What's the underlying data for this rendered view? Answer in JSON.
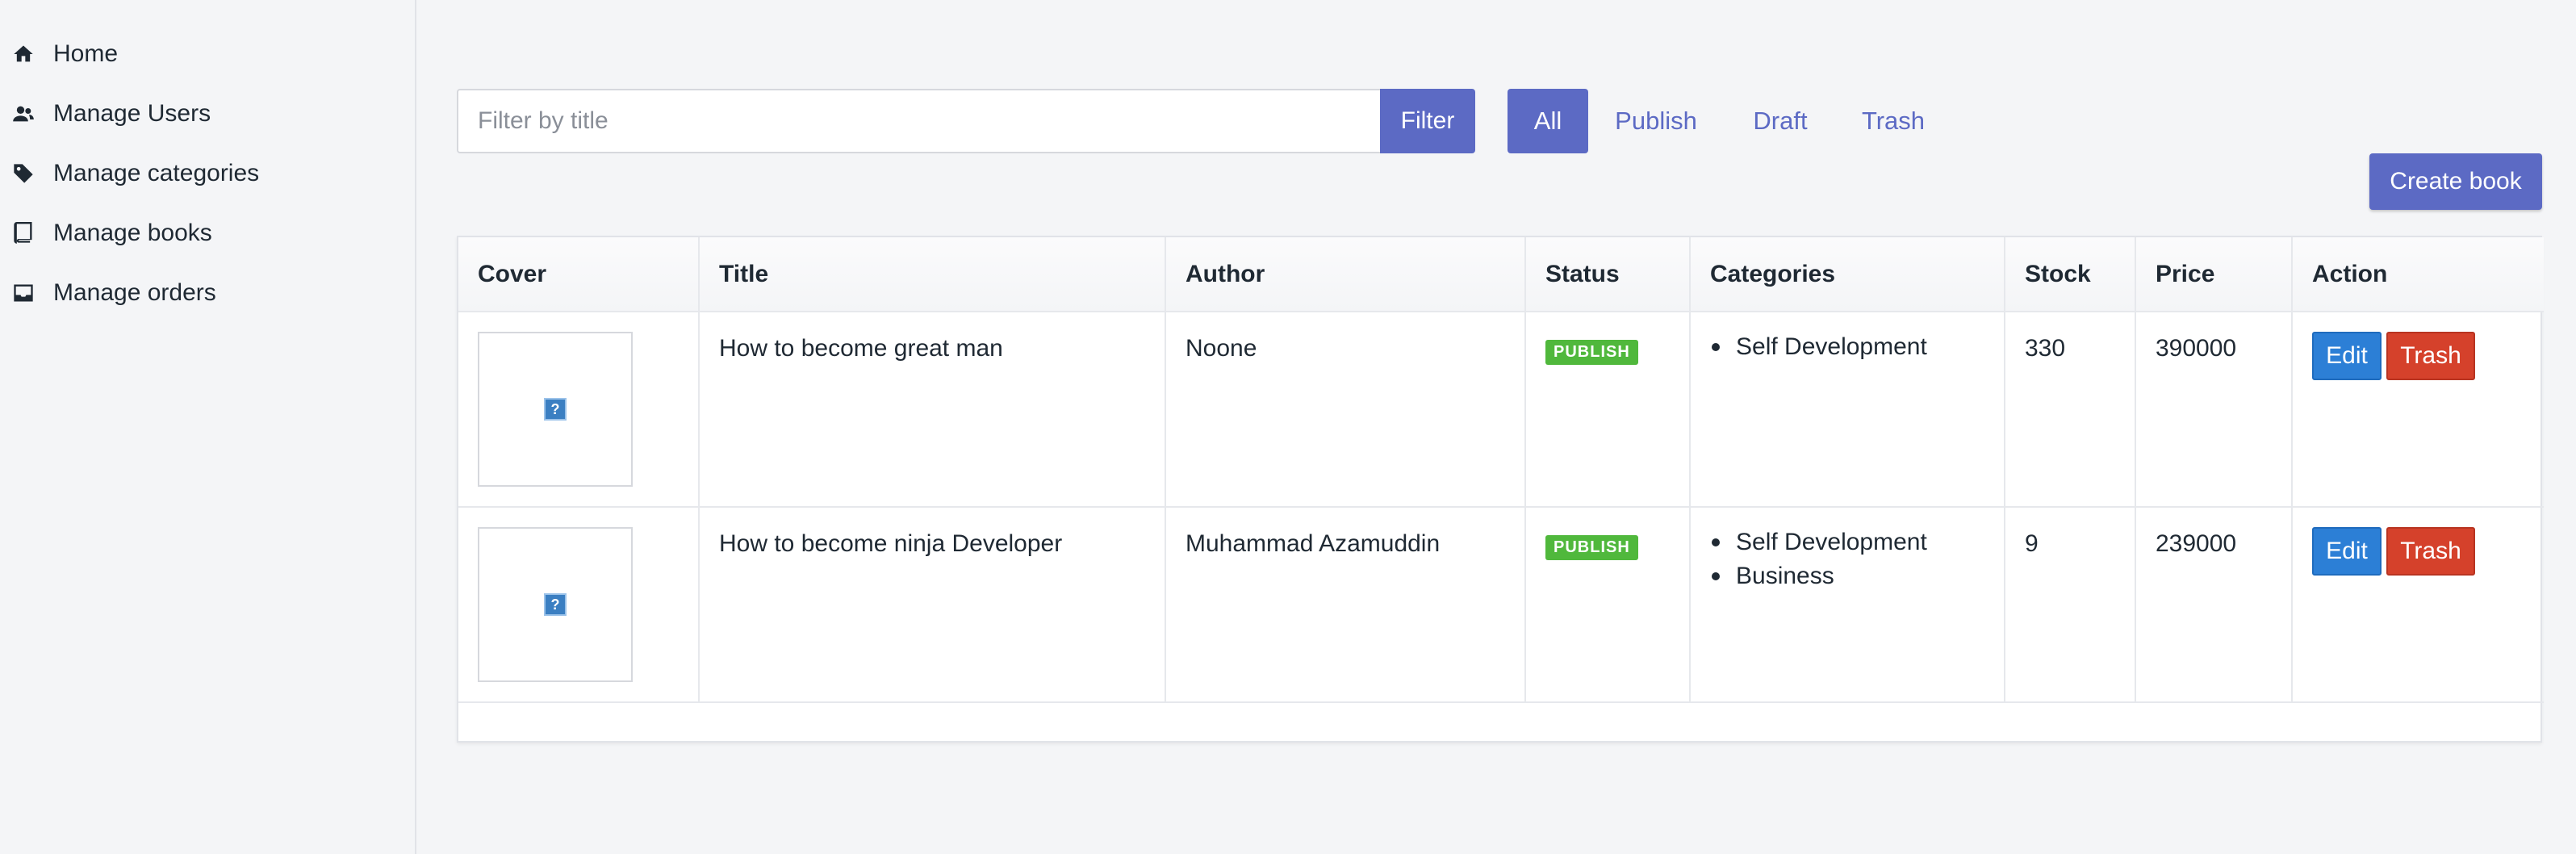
{
  "sidebar": {
    "items": [
      {
        "label": "Home",
        "icon": "home-icon"
      },
      {
        "label": "Manage Users",
        "icon": "users-icon"
      },
      {
        "label": "Manage categories",
        "icon": "tag-icon"
      },
      {
        "label": "Manage books",
        "icon": "book-icon"
      },
      {
        "label": "Manage orders",
        "icon": "inbox-icon"
      }
    ]
  },
  "filter": {
    "placeholder": "Filter by title",
    "value": "",
    "button_label": "Filter"
  },
  "tabs": [
    {
      "label": "All",
      "active": true
    },
    {
      "label": "Publish",
      "active": false
    },
    {
      "label": "Draft",
      "active": false
    },
    {
      "label": "Trash",
      "active": false
    }
  ],
  "create_button_label": "Create book",
  "table": {
    "columns": [
      "Cover",
      "Title",
      "Author",
      "Status",
      "Categories",
      "Stock",
      "Price",
      "Action"
    ],
    "rows": [
      {
        "title": "How to become great man",
        "author": "Noone",
        "status": "PUBLISH",
        "categories": [
          "Self Development"
        ],
        "stock": "330",
        "price": "390000",
        "edit_label": "Edit",
        "trash_label": "Trash"
      },
      {
        "title": "How to become ninja Developer",
        "author": "Muhammad Azamuddin",
        "status": "PUBLISH",
        "categories": [
          "Self Development",
          "Business"
        ],
        "stock": "9",
        "price": "239000",
        "edit_label": "Edit",
        "trash_label": "Trash"
      }
    ]
  },
  "colors": {
    "primary": "#5c6ac4",
    "publish_badge": "#50b83c",
    "edit": "#2c7fd6",
    "trash": "#d5412b"
  }
}
